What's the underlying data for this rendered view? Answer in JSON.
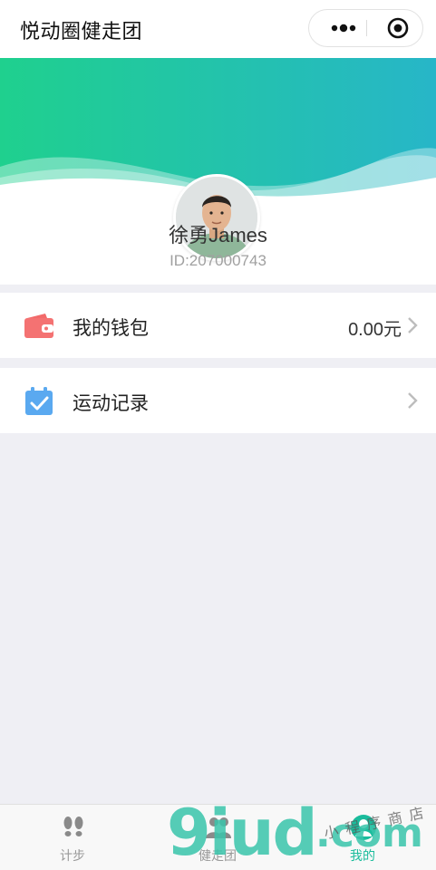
{
  "app": {
    "title": "悦动圈健走团"
  },
  "header_controls": {
    "more_icon": "more-dots-icon",
    "close_icon": "target-close-icon"
  },
  "profile": {
    "name": "徐勇James",
    "id_text": "ID:207000743",
    "avatar_icon": "user-avatar"
  },
  "menu": {
    "wallet": {
      "label": "我的钱包",
      "value": "0.00元",
      "icon": "wallet-icon",
      "icon_color": "#f26a6a"
    },
    "records": {
      "label": "运动记录",
      "icon": "calendar-check-icon",
      "icon_color": "#5aa9f0"
    }
  },
  "tabs": [
    {
      "label": "计步",
      "icon": "footprints-icon",
      "active": false
    },
    {
      "label": "健走团",
      "icon": "group-icon",
      "active": false
    },
    {
      "label": "我的",
      "icon": "person-icon",
      "active": true
    }
  ],
  "watermark": {
    "brand": "9iud",
    "suffix": ".com",
    "tagline": "小程序商店"
  },
  "colors": {
    "banner_gradient_start": "#1fcf91",
    "banner_gradient_end": "#2bb8c6",
    "active_tab": "#1abc9c",
    "page_background": "#efeff4"
  }
}
